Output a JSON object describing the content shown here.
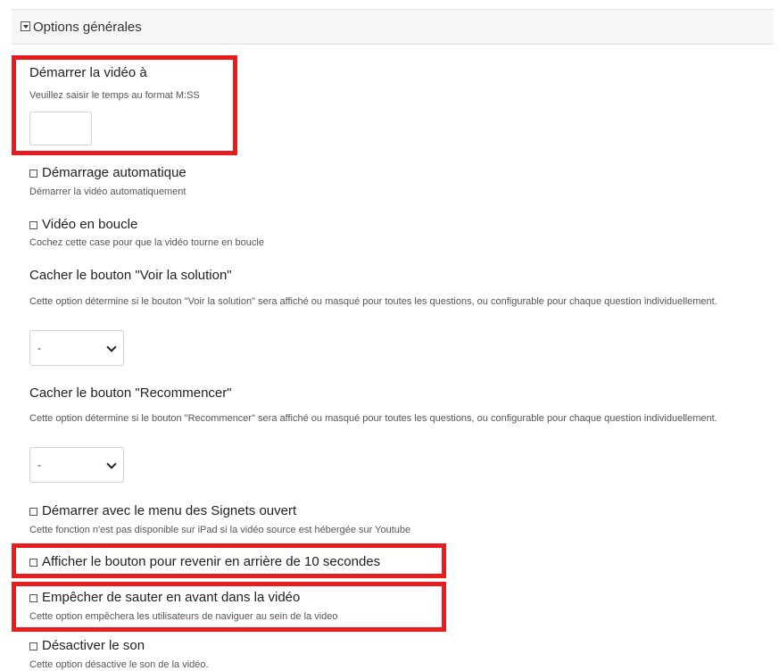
{
  "panel": {
    "title": "Options générales"
  },
  "start_time": {
    "label": "Démarrer la vidéo à",
    "hint": "Veuillez saisir le temps au format M:SS",
    "value": ""
  },
  "autoplay": {
    "label": "Démarrage automatique",
    "desc": "Démarrer la vidéo automatiquement",
    "checked": false
  },
  "loop": {
    "label": "Vidéo en boucle",
    "desc": "Cochez cette case pour que la vidéo tourne en boucle",
    "checked": false
  },
  "hide_solution": {
    "label": "Cacher le bouton \"Voir la solution\"",
    "desc": "Cette option détermine si le bouton \"Voir la solution\" sera affiché ou masqué pour toutes les questions, ou configurable pour chaque question individuellement.",
    "selected": "-"
  },
  "hide_retry": {
    "label": "Cacher le bouton \"Recommencer\"",
    "desc": "Cette option détermine si le bouton \"Recommencer\" sera affiché ou masqué pour toutes les questions, ou configurable pour chaque question individuellement.",
    "selected": "-"
  },
  "bookmarks": {
    "label": "Démarrer avec le menu des Signets ouvert",
    "desc": "Cette fonction n'est pas disponible sur iPad si la vidéo source est hébergée sur Youtube",
    "checked": false
  },
  "rewind": {
    "label": "Afficher le bouton pour revenir en arrière de 10 secondes",
    "checked": false
  },
  "prevent_skip": {
    "label": "Empêcher de sauter en avant dans la vidéo",
    "desc": "Cette option empêchera les utilisateurs de naviguer au sein de la video",
    "checked": false
  },
  "mute": {
    "label": "Désactiver le son",
    "desc": "Cette option désactive le son de la vidéo.",
    "checked": false
  },
  "colors": {
    "highlight": "#e81c1c"
  }
}
